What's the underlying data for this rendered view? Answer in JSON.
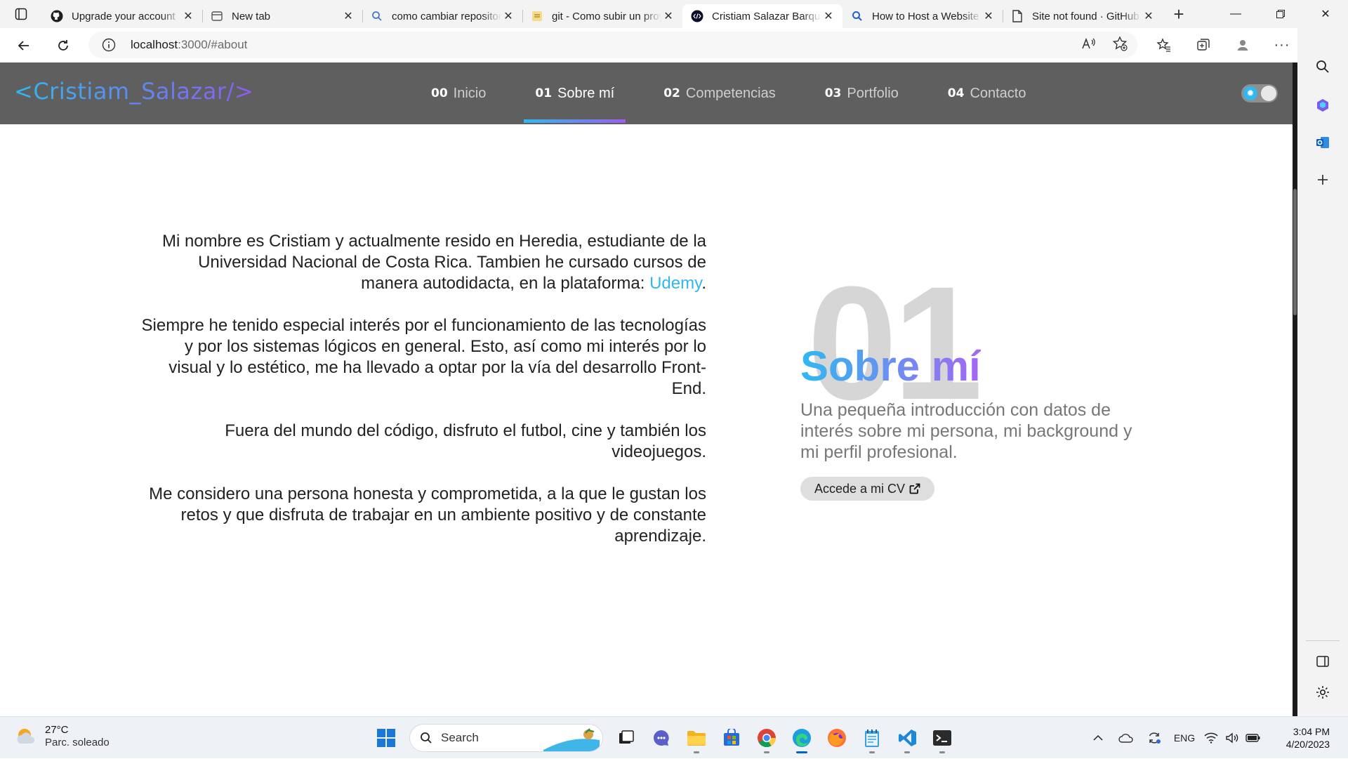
{
  "browser": {
    "tabs": [
      {
        "title": "Upgrade your account",
        "icon": "github-icon",
        "active": false
      },
      {
        "title": "New tab",
        "icon": "new-tab-icon",
        "active": false
      },
      {
        "title": "como cambiar repositorio",
        "icon": "search-icon",
        "active": false
      },
      {
        "title": "git - Como subir un proyecto",
        "icon": "stackoverflow-icon",
        "active": false
      },
      {
        "title": "Cristiam Salazar Barquero",
        "icon": "site-icon",
        "active": true
      },
      {
        "title": "How to Host a Website",
        "icon": "search-icon",
        "active": false
      },
      {
        "title": "Site not found · GitHub",
        "icon": "page-icon",
        "active": false
      }
    ],
    "url_host": "localhost",
    "url_path": ":3000/#about"
  },
  "site": {
    "logo": "<Cristiam_Salazar/>",
    "menu": [
      {
        "num": "00",
        "label": "Inicio",
        "active": false
      },
      {
        "num": "01",
        "label": "Sobre mí",
        "active": true
      },
      {
        "num": "02",
        "label": "Competencias",
        "active": false
      },
      {
        "num": "03",
        "label": "Portfolio",
        "active": false
      },
      {
        "num": "04",
        "label": "Contacto",
        "active": false
      }
    ],
    "about": {
      "p1_before": "Mi nombre es Cristiam y actualmente resido en Heredia, estudiante de la Universidad Nacional de Costa Rica. Tambien he cursado cursos de manera autodidacta, en la plataforma: ",
      "p1_link": "Udemy",
      "p1_after": ".",
      "p2": "Siempre he tenido especial interés por el funcionamiento de las tecnologías y por los sistemas lógicos en general. Esto, así como mi interés por lo visual y lo estético, me ha llevado a optar por la vía del desarrollo Front-End.",
      "p3": "Fuera del mundo del código, disfruto el futbol, cine y también los videojuegos.",
      "p4": "Me considero una persona honesta y comprometida, a la que le gustan los retos y que disfruta de trabajar en un ambiente positivo y de constante aprendizaje."
    },
    "section": {
      "number": "01",
      "title": "Sobre mí",
      "subtitle": "Una pequeña introducción con datos de interés sobre mi persona, mi background y mi perfil profesional.",
      "cv_button": "Accede a mi CV"
    }
  },
  "taskbar": {
    "weather_temp": "27°C",
    "weather_cond": "Parc. soleado",
    "search_label": "Search",
    "lang": "ENG",
    "time": "3:04 PM",
    "date": "4/20/2023"
  },
  "colors": {
    "accent_blue": "#2fb9f0",
    "accent_purple": "#9a5ef0",
    "nav_bg": "#5f5f5f"
  }
}
